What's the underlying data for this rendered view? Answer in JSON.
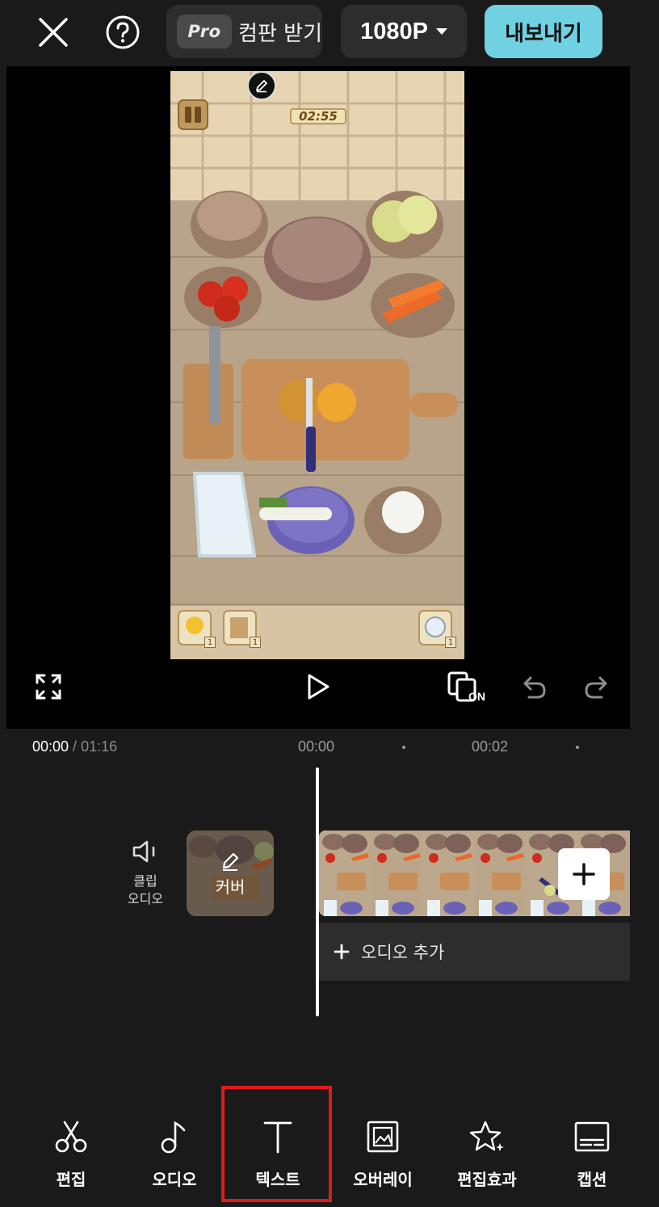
{
  "topbar": {
    "close_icon": "close-icon",
    "help_icon": "help-icon",
    "pro_badge": "Pro",
    "pro_text": "컴판 받기",
    "resolution": "1080P",
    "export_label": "내보내기"
  },
  "preview": {
    "game_timer": "02:55",
    "badge_counts": [
      "1",
      "1",
      "1"
    ]
  },
  "playbar": {
    "fullscreen_icon": "fullscreen-icon",
    "play_icon": "play-icon",
    "keyframe_label": "ON",
    "undo_icon": "undo-icon",
    "redo_icon": "redo-icon"
  },
  "timeline": {
    "current_time": "00:00",
    "separator": " / ",
    "total_time": "01:16",
    "ticks": [
      "00:00",
      "00:02"
    ],
    "clip_audio_label": "클립\n오디오",
    "cover_label": "커버",
    "add_audio_label": "오디오 추가"
  },
  "toolbar": {
    "items": [
      {
        "label": "편집",
        "icon": "scissors-icon"
      },
      {
        "label": "오디오",
        "icon": "music-note-icon"
      },
      {
        "label": "텍스트",
        "icon": "text-icon"
      },
      {
        "label": "오버레이",
        "icon": "overlay-icon"
      },
      {
        "label": "편집효과",
        "icon": "effects-star-icon"
      },
      {
        "label": "캡션",
        "icon": "caption-icon"
      }
    ]
  },
  "colors": {
    "accent_export": "#6fd1e2",
    "highlight_box": "#e0191f",
    "background": "#1a1a1a"
  }
}
